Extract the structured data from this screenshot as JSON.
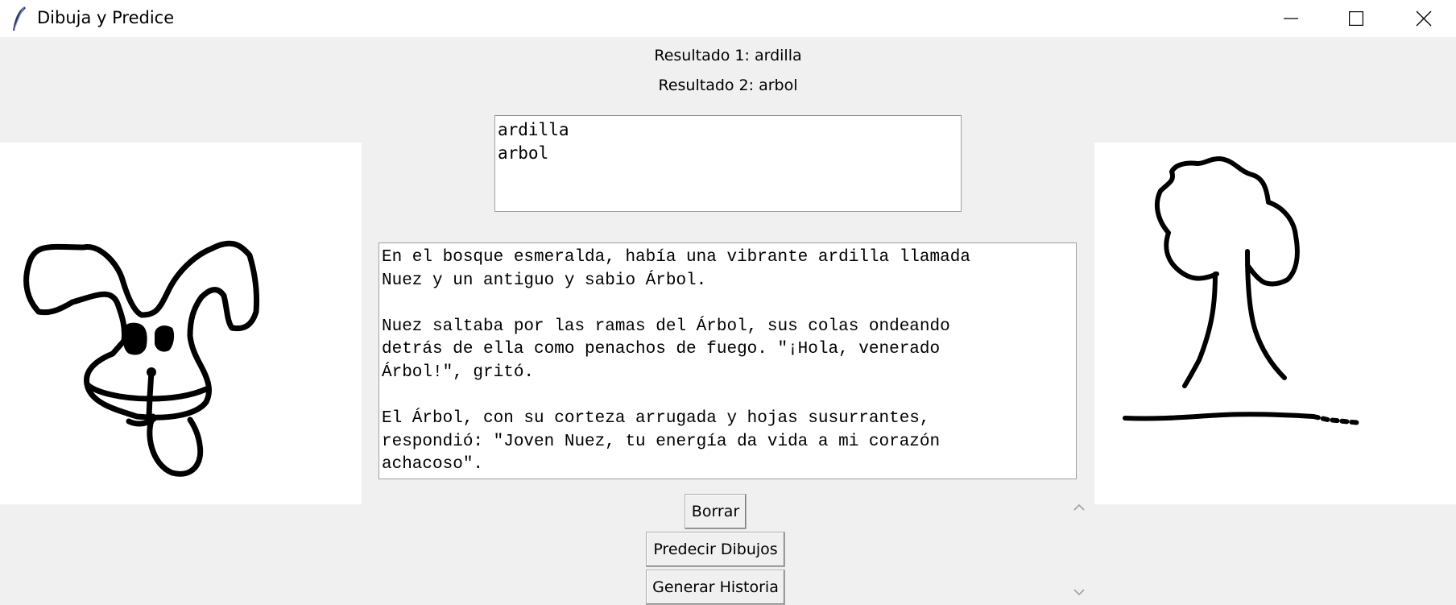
{
  "window": {
    "title": "Dibuja y Predice",
    "app_icon": "feather-icon",
    "controls": [
      "minimize-icon",
      "maximize-icon",
      "close-icon"
    ]
  },
  "results": {
    "result1": "Resultado 1: ardilla",
    "result2": "Resultado 2: arbol"
  },
  "listbox": {
    "items": [
      "ardilla",
      "arbol"
    ]
  },
  "story": {
    "paragraphs": [
      "En el bosque esmeralda, había una vibrante ardilla llamada\nNuez y un antiguo y sabio Árbol.",
      "Nuez saltaba por las ramas del Árbol, sus colas ondeando\ndetrás de ella como penachos de fuego. \"¡Hola, venerado\nÁrbol!\", gritó.",
      "El Árbol, con su corteza arrugada y hojas susurrantes,\nrespondió: \"Joven Nuez, tu energía da vida a mi corazón\nachacoso\"."
    ]
  },
  "buttons": {
    "clear": "Borrar",
    "predict": "Predecir Dibujos",
    "generate": "Generar Historia"
  },
  "canvases": {
    "left": "drawing-squirrel",
    "right": "drawing-tree"
  }
}
